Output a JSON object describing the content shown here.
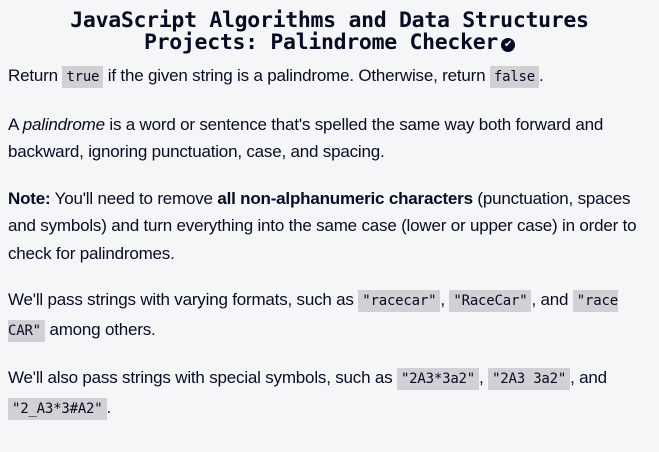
{
  "title": {
    "line1": "JavaScript Algorithms and Data Structures",
    "line2": "Projects: Palindrome Checker",
    "completed_icon": "check-circle-icon"
  },
  "p1": {
    "a": "Return ",
    "code1": "true",
    "b": " if the given string is a palindrome. Otherwise, return ",
    "code2": "false",
    "c": "."
  },
  "p2": {
    "a": "A ",
    "em": "palindrome",
    "b": " is a word or sentence that's spelled the same way both forward and backward, ignoring punctuation, case, and spacing."
  },
  "p3": {
    "strong1": "Note:",
    "a": " You'll need to remove ",
    "strong2": "all non-alphanumeric characters",
    "b": " (punctuation, spaces and symbols) and turn everything into the same case (lower or upper case) in order to check for palindromes."
  },
  "p4": {
    "a": "We'll pass strings with varying formats, such as ",
    "code1": "\"racecar\"",
    "b": ", ",
    "code2": "\"RaceCar\"",
    "c": ", and ",
    "code3": "\"race CAR\"",
    "d": " among others."
  },
  "p5": {
    "a": "We'll also pass strings with special symbols, such as ",
    "code1": "\"2A3*3a2\"",
    "b": ", ",
    "code2": "\"2A3 3a2\"",
    "c": ", and ",
    "code3": "\"2_A3*3#A2\"",
    "d": "."
  }
}
